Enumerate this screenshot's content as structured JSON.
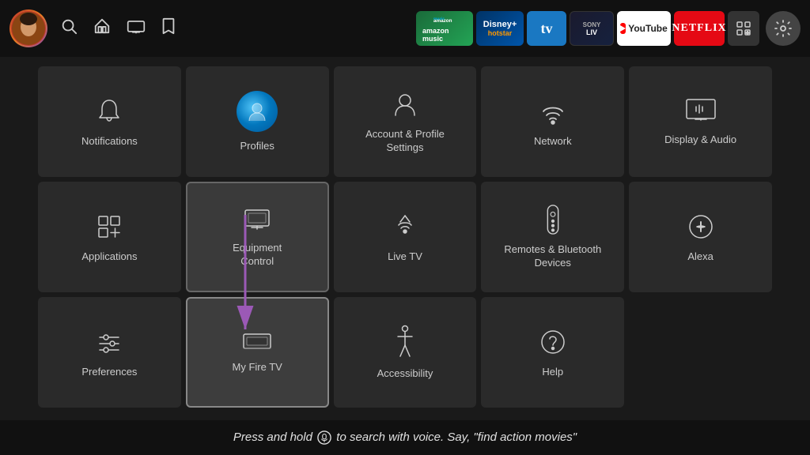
{
  "nav": {
    "apps": [
      {
        "id": "amazon-music",
        "label": "amazon music",
        "bg": "#1a6b3a"
      },
      {
        "id": "disney-hotstar",
        "label": "Disney+\nHotstar",
        "bg": "#003399"
      },
      {
        "id": "tv",
        "label": "tv",
        "bg": "#1a78c2"
      },
      {
        "id": "sonyliv",
        "label": "SONY LIV",
        "bg": "#111"
      },
      {
        "id": "youtube",
        "label": "YouTube",
        "bg": "#fff"
      },
      {
        "id": "netflix",
        "label": "NETFLIX",
        "bg": "#e50914"
      },
      {
        "id": "more",
        "label": "⊞",
        "bg": "#333"
      }
    ]
  },
  "tiles": [
    {
      "id": "notifications",
      "label": "Notifications"
    },
    {
      "id": "profiles",
      "label": "Profiles"
    },
    {
      "id": "account",
      "label": "Account & Profile\nSettings"
    },
    {
      "id": "network",
      "label": "Network"
    },
    {
      "id": "display-audio",
      "label": "Display & Audio"
    },
    {
      "id": "applications",
      "label": "Applications"
    },
    {
      "id": "equipment-control",
      "label": "Equipment\nControl"
    },
    {
      "id": "live-tv",
      "label": "Live TV"
    },
    {
      "id": "remotes-bluetooth",
      "label": "Remotes & Bluetooth\nDevices"
    },
    {
      "id": "alexa",
      "label": "Alexa"
    },
    {
      "id": "preferences",
      "label": "Preferences"
    },
    {
      "id": "my-fire-tv",
      "label": "My Fire TV"
    },
    {
      "id": "accessibility",
      "label": "Accessibility"
    },
    {
      "id": "help",
      "label": "Help"
    }
  ],
  "bottom_text_pre": "Press and hold ",
  "bottom_text_post": " to search with voice. Say, \"find action movies\""
}
